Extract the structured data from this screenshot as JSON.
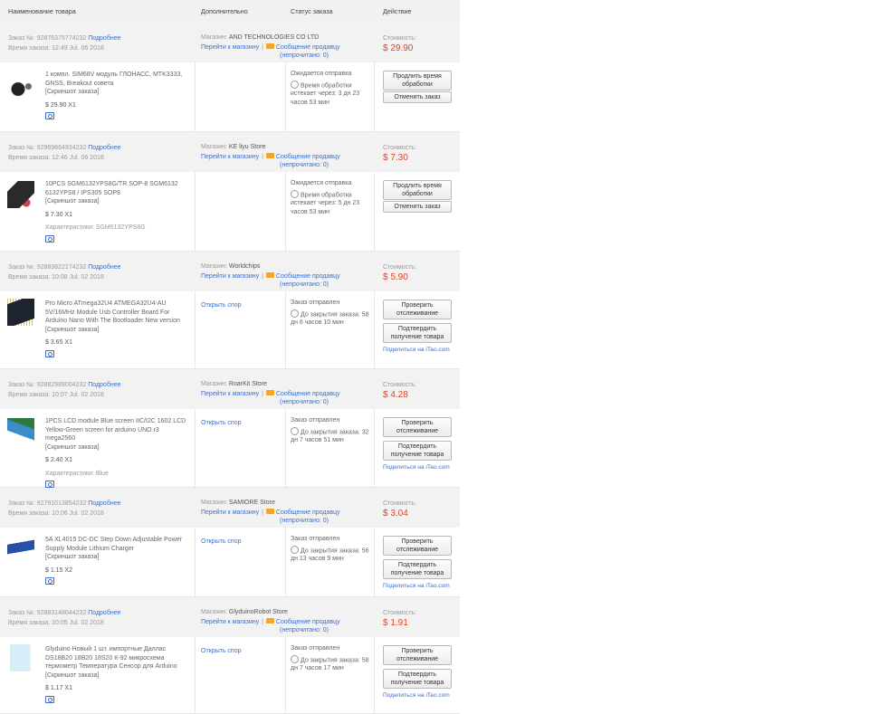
{
  "header": {
    "col_product": "Наименование товара",
    "col_extra": "Дополнительно",
    "col_status": "Статус заказа",
    "col_action": "Действие"
  },
  "labels": {
    "order_no": "Заказ №:",
    "order_time": "Время заказа:",
    "details": "Подробнее",
    "shop": "Магазин:",
    "go_shop": "Перейти к магазину",
    "sep": "|",
    "msg_seller": "Сообщение продавцу",
    "unread": "(непрочитано:",
    "unread_close": ")",
    "cost": "Стоимость:",
    "screenshot": "[Скриншот заказа]",
    "characteristics": "Характеристики:",
    "dispute": "Открыть спор",
    "share_prefix": "Поделиться на",
    "share_site": "iTao.com"
  },
  "orders": [
    {
      "number": "92876375774232",
      "time": "12:49 Jul. 06 2018",
      "shop": "AND TECHNOLOGIES CO LTD",
      "unread": "0",
      "cost": "$ 29.90",
      "product": "1 компл. SIM68V модуль ГЛОНАСС, MTK3333, GNSS, Breakout совета",
      "price_qty": "$ 29.90 X1",
      "characteristics": "",
      "extra_link": "",
      "status": "Ожидается отправка",
      "status_detail": "Время обработки истекает через: 3 дн 23 часов 53 мин",
      "btn1": "Продлить время обработки",
      "btn2": "Отменить заказ",
      "share": false
    },
    {
      "number": "92969864934232",
      "time": "12:46 Jul. 06 2018",
      "shop": "KE liyu Store",
      "unread": "0",
      "cost": "$ 7.30",
      "product": "10PCS SGM6132YPS8G/TR SOP-8 SGM6132 6132YPS8 / IPS305 SOP8",
      "price_qty": "$ 7.30 X1",
      "characteristics": "SGM6132YPS8G",
      "extra_link": "",
      "status": "Ожидается отправка",
      "status_detail": "Время обработки истекает через: 5 дн 23 часов 53 мин",
      "btn1": "Продлить время обработки",
      "btn2": "Отменить заказ",
      "share": false
    },
    {
      "number": "92883822174232",
      "time": "10:08 Jul. 02 2018",
      "shop": "Worldchips",
      "unread": "0",
      "cost": "$ 5.90",
      "product": "Pro Micro ATmega32U4 ATMEGA32U4-AU 5V/16MHz Module Usb Controller Board For Arduino Nano With The Bootloader New version",
      "price_qty": "$ 3.65 X1",
      "characteristics": "",
      "extra_link": "Открыть спор",
      "status": "Заказ отправлен",
      "status_detail": "До закрытия заказа: 58 дн 6 часов 10 мин",
      "btn1": "Проверить отслеживание",
      "btn2": "Подтвердить получение товара",
      "share": true
    },
    {
      "number": "92882989004232",
      "time": "10:07 Jul. 02 2018",
      "shop": "RoarKit Store",
      "unread": "0",
      "cost": "$ 4.28",
      "product": "1PCS LCD module Blue screen IIC/I2C 1602 LCD Yellow-Green screen for arduino UNO r3 mega2560",
      "price_qty": "$ 2.40 X1",
      "characteristics": "Blue",
      "extra_link": "Открыть спор",
      "status": "Заказ отправлен",
      "status_detail": "До закрытия заказа: 32 дн 7 часов 51 мин",
      "btn1": "Проверить отслеживание",
      "btn2": "Подтвердить получение товара",
      "share": true
    },
    {
      "number": "92791013854232",
      "time": "10:06 Jul. 02 2018",
      "shop": "SAMIORE Store",
      "unread": "0",
      "cost": "$ 3.04",
      "product": "5A XL4015 DC-DC Step Down Adjustable Power Supply Module Lithium Charger",
      "price_qty": "$ 1.15 X2",
      "characteristics": "",
      "extra_link": "Открыть спор",
      "status": "Заказ отправлен",
      "status_detail": "До закрытия заказа: 56 дн 13 часов 9 мин",
      "btn1": "Проверить отслеживание",
      "btn2": "Подтвердить получение товара",
      "share": true
    },
    {
      "number": "92883148044232",
      "time": "10:05 Jul. 02 2018",
      "shop": "GlyduinoRobot Store",
      "unread": "0",
      "cost": "$ 1.91",
      "product": "Glyduino Новый 1 шт. импортные Даллас DS18B20 18B20 18S20 К-92 микросхема термометр Температура Сенсор для Arduino",
      "price_qty": "$ 1.17 X1",
      "characteristics": "",
      "extra_link": "Открыть спор",
      "status": "Заказ отправлен",
      "status_detail": "До закрытия заказа: 58 дн 7 часов 17 мин",
      "btn1": "Проверить отслеживание",
      "btn2": "Подтвердить получение товара",
      "share": true
    }
  ]
}
